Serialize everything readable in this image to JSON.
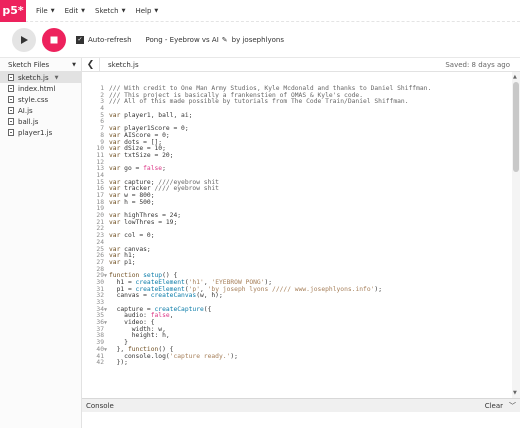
{
  "app": {
    "logo": "p5*",
    "menu": [
      {
        "label": "File"
      },
      {
        "label": "Edit"
      },
      {
        "label": "Sketch"
      },
      {
        "label": "Help"
      }
    ]
  },
  "toolbar": {
    "auto_refresh_label": "Auto-refresh",
    "auto_refresh_checked": true,
    "project_name": "Pong - Eyebrow vs AI",
    "author": "by josephlyons"
  },
  "sidebar": {
    "title": "Sketch Files",
    "files": [
      {
        "name": "sketch.js",
        "active": true
      },
      {
        "name": "index.html",
        "active": false
      },
      {
        "name": "style.css",
        "active": false
      },
      {
        "name": "AI.js",
        "active": false
      },
      {
        "name": "ball.js",
        "active": false
      },
      {
        "name": "player1.js",
        "active": false
      }
    ]
  },
  "editor": {
    "filename": "sketch.js",
    "saved_status": "Saved: 8 days ago",
    "lines": [
      {
        "n": "1",
        "fold": "",
        "code": "/// With credit to One Man Army Studios, Kyle Mcdonald and thanks to Daniel Shiffman."
      },
      {
        "n": "2",
        "fold": "",
        "code": "/// This project is basically a frankenstien of OMAS & Kyle's code."
      },
      {
        "n": "3",
        "fold": "",
        "code": "/// All of this made possible by tutorials from The Code Train/Daniel Shiffman."
      },
      {
        "n": "4",
        "fold": "",
        "code": ""
      },
      {
        "n": "5",
        "fold": "",
        "code": "var player1, ball, ai;"
      },
      {
        "n": "6",
        "fold": "",
        "code": ""
      },
      {
        "n": "7",
        "fold": "",
        "code": "var player1Score = 0;"
      },
      {
        "n": "8",
        "fold": "",
        "code": "var AIScore = 0;"
      },
      {
        "n": "9",
        "fold": "",
        "code": "var dots = [];"
      },
      {
        "n": "10",
        "fold": "",
        "code": "var dSize = 10;"
      },
      {
        "n": "11",
        "fold": "",
        "code": "var txtSize = 20;"
      },
      {
        "n": "12",
        "fold": "",
        "code": ""
      },
      {
        "n": "13",
        "fold": "",
        "code": "var go = false;"
      },
      {
        "n": "14",
        "fold": "",
        "code": ""
      },
      {
        "n": "15",
        "fold": "",
        "code": "var capture; ////eyebrow shit"
      },
      {
        "n": "16",
        "fold": "",
        "code": "var tracker //// eyebrow shit"
      },
      {
        "n": "17",
        "fold": "",
        "code": "var w = 800;"
      },
      {
        "n": "18",
        "fold": "",
        "code": "var h = 500;"
      },
      {
        "n": "19",
        "fold": "",
        "code": ""
      },
      {
        "n": "20",
        "fold": "",
        "code": "var highThres = 24;"
      },
      {
        "n": "21",
        "fold": "",
        "code": "var lowThres = 19;"
      },
      {
        "n": "22",
        "fold": "",
        "code": ""
      },
      {
        "n": "23",
        "fold": "",
        "code": "var col = 0;"
      },
      {
        "n": "24",
        "fold": "",
        "code": ""
      },
      {
        "n": "25",
        "fold": "",
        "code": "var canvas;"
      },
      {
        "n": "26",
        "fold": "",
        "code": "var h1;"
      },
      {
        "n": "27",
        "fold": "",
        "code": "var p1;"
      },
      {
        "n": "28",
        "fold": "",
        "code": ""
      },
      {
        "n": "29",
        "fold": "▼",
        "code": "function setup() {"
      },
      {
        "n": "30",
        "fold": "",
        "code": "  h1 = createElement('h1', 'EYEBROW PONG');"
      },
      {
        "n": "31",
        "fold": "",
        "code": "  p1 = createElement('p', 'by joseph lyons ///// www.josephlyons.info');"
      },
      {
        "n": "32",
        "fold": "",
        "code": "  canvas = createCanvas(w, h);"
      },
      {
        "n": "33",
        "fold": "",
        "code": ""
      },
      {
        "n": "34",
        "fold": "▼",
        "code": "  capture = createCapture({"
      },
      {
        "n": "35",
        "fold": "",
        "code": "    audio: false,"
      },
      {
        "n": "36",
        "fold": "▼",
        "code": "    video: {"
      },
      {
        "n": "37",
        "fold": "",
        "code": "      width: w,"
      },
      {
        "n": "38",
        "fold": "",
        "code": "      height: h,"
      },
      {
        "n": "39",
        "fold": "",
        "code": "    }"
      },
      {
        "n": "40",
        "fold": "▼",
        "code": "  }, function() {"
      },
      {
        "n": "41",
        "fold": "",
        "code": "    console.log('capture ready.');"
      },
      {
        "n": "42",
        "fold": "",
        "code": "  });"
      }
    ]
  },
  "console": {
    "label": "Console",
    "clear_label": "Clear"
  },
  "colors": {
    "brand": "#ed225d",
    "comment": "#666666",
    "keyword": "#704f21",
    "string": "#a67f59",
    "function": "#0b7ca9"
  }
}
